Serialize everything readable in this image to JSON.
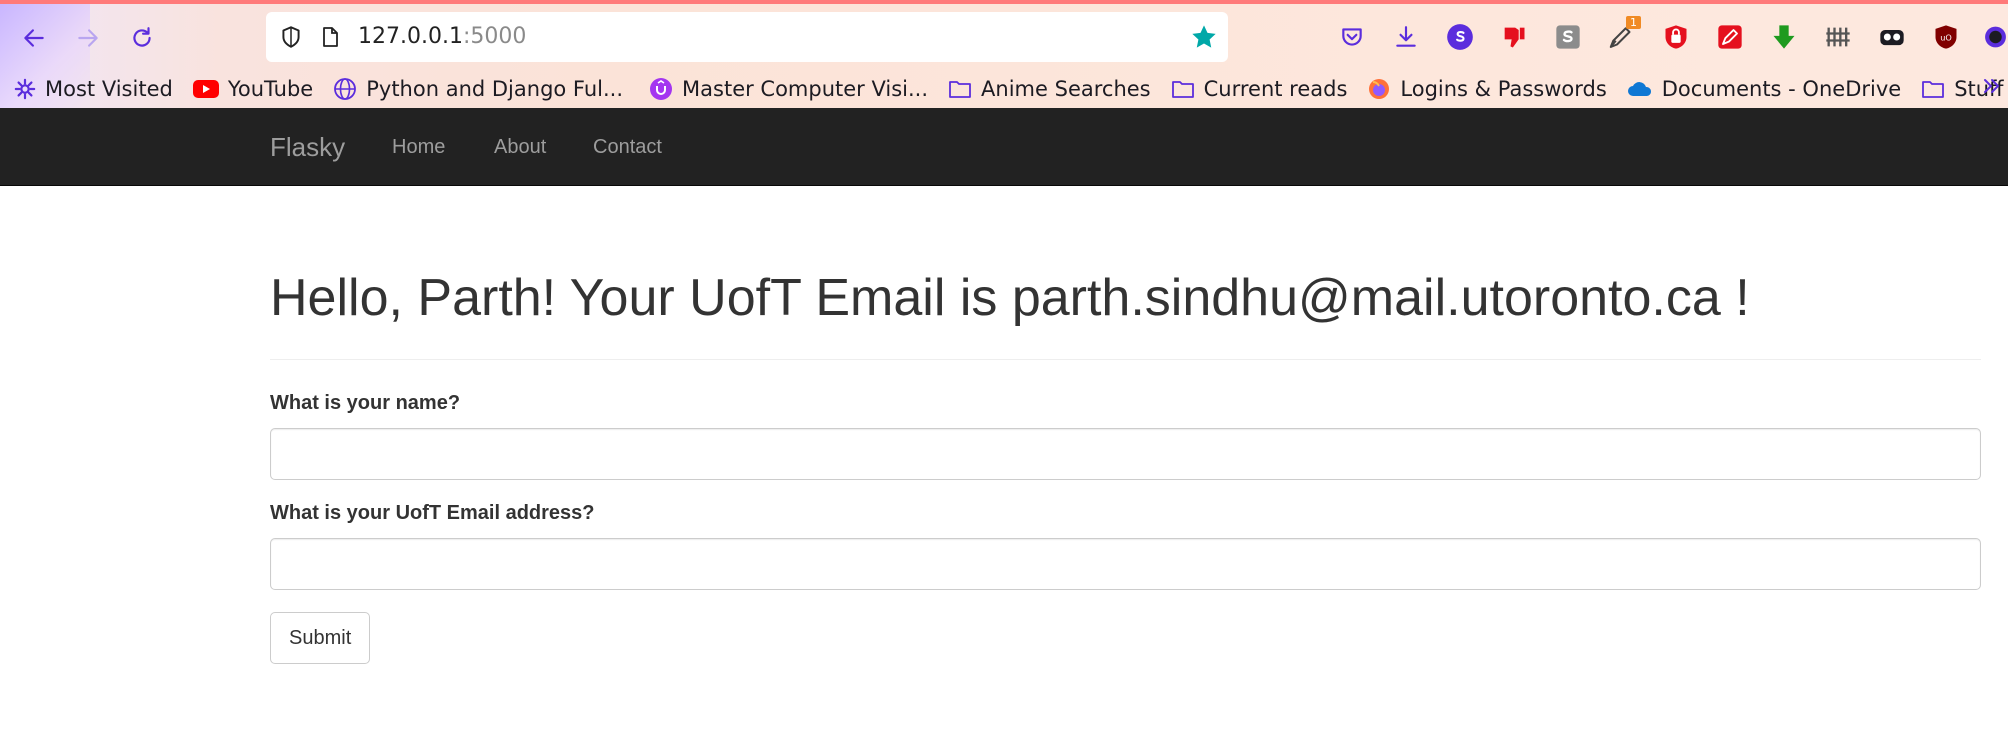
{
  "browser": {
    "url_host": "127.0.0.1",
    "url_port": ":5000",
    "extension_badge": "1",
    "colors": {
      "accent_star": "#00a8a8",
      "toolbar_accent": "#5b2ddd"
    },
    "bookmarks": [
      {
        "label": "Most Visited",
        "icon": "gear-icon"
      },
      {
        "label": "YouTube",
        "icon": "youtube-icon"
      },
      {
        "label": "Python and Django Ful...",
        "icon": "globe-icon"
      },
      {
        "label": "Master Computer Visi...",
        "icon": "udemy-icon"
      },
      {
        "label": "Anime Searches",
        "icon": "folder-icon"
      },
      {
        "label": "Current reads",
        "icon": "folder-icon"
      },
      {
        "label": "Logins & Passwords",
        "icon": "firefox-icon"
      },
      {
        "label": "Documents - OneDrive",
        "icon": "onedrive-icon"
      },
      {
        "label": "Stuff",
        "icon": "folder-icon"
      }
    ]
  },
  "navbar": {
    "brand": "Flasky",
    "links": [
      "Home",
      "About",
      "Contact"
    ],
    "colors": {
      "background": "#222222",
      "text": "#9d9d9d"
    }
  },
  "main": {
    "heading": "Hello, Parth! Your UofT Email is parth.sindhu@mail.utoronto.ca !",
    "form": {
      "name_label": "What is your name?",
      "name_value": "",
      "email_label": "What is your UofT Email address?",
      "email_value": "",
      "submit_label": "Submit"
    }
  }
}
